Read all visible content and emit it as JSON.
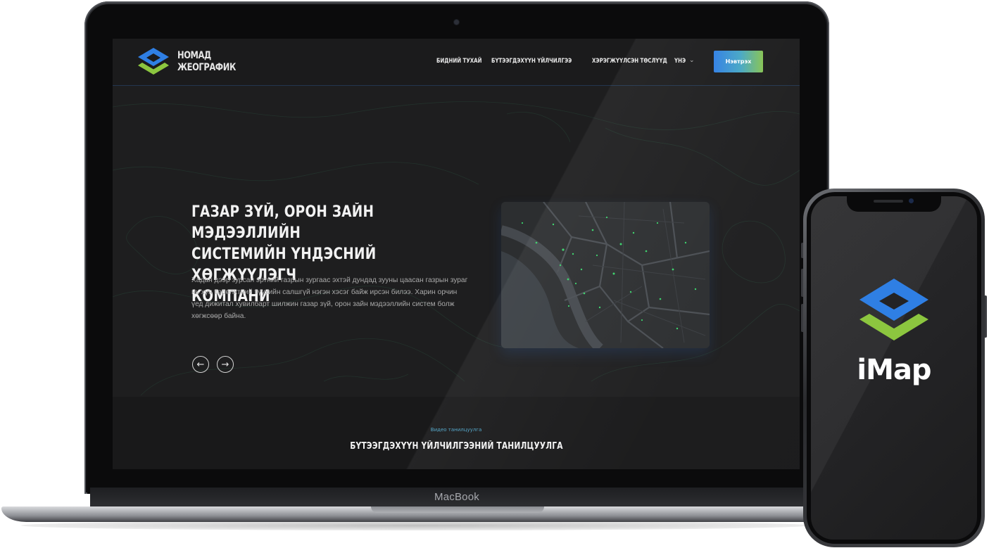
{
  "site": {
    "brand": {
      "line1": "НОМАД",
      "line2": "ЖЕОГРАФИК"
    },
    "nav": [
      {
        "label": "БИДНИЙ ТУХАЙ",
        "dropdown": false
      },
      {
        "label": "БҮТЭЭГДЭХҮҮН ҮЙЛЧИЛГЭЭ",
        "dropdown": true
      },
      {
        "label": "ХЭРЭГЖҮҮЛСЭН ТӨСЛҮҮД",
        "dropdown": false
      },
      {
        "label": "ҮНЭ",
        "dropdown": true
      }
    ],
    "login_label": "Нэвтрэх",
    "hero": {
      "title_line1": "ГАЗАР ЗҮЙ, ОРОН ЗАЙН МЭДЭЭЛЛИЙН",
      "title_line2": "СИСТЕМИЙН ҮНДЭСНИЙ ХӨГЖҮҮЛЭГЧ",
      "title_line3": "КОМПАНИ",
      "text_line1": "Хадан дээр зурсан эртний газрын зургаас эхтэй дундад зууны цаасан газрын зураг",
      "text_line2": "нь хүн төрөлхтний түүхийн салшгүй нэгэн хэсэг байж ирсэн билээ. Харин орчин",
      "text_line3": "үед дижитал хувилбарт шилжин газар зүй, орон зайн мэдээллийн систем болж",
      "text_line4": "хөгжсөөр байна.",
      "prev_symbol": "←",
      "next_symbol": "→"
    },
    "section": {
      "eyebrow": "Видео танилцуулга",
      "title": "БҮТЭЭГДЭХҮҮН ҮЙЛЧИЛГЭЭНИЙ ТАНИЛЦУУЛГА"
    }
  },
  "device": {
    "laptop_label": "MacBook"
  },
  "phone_app": {
    "name": "iMap"
  },
  "colors": {
    "brand_blue": "#2f7fe4",
    "brand_green": "#8cc63f",
    "accent_cyan": "#46a7c4"
  },
  "icons": [
    "logo-layers-icon",
    "chevron-down-icon",
    "arrow-left-icon",
    "arrow-right-icon",
    "camera-icon"
  ]
}
